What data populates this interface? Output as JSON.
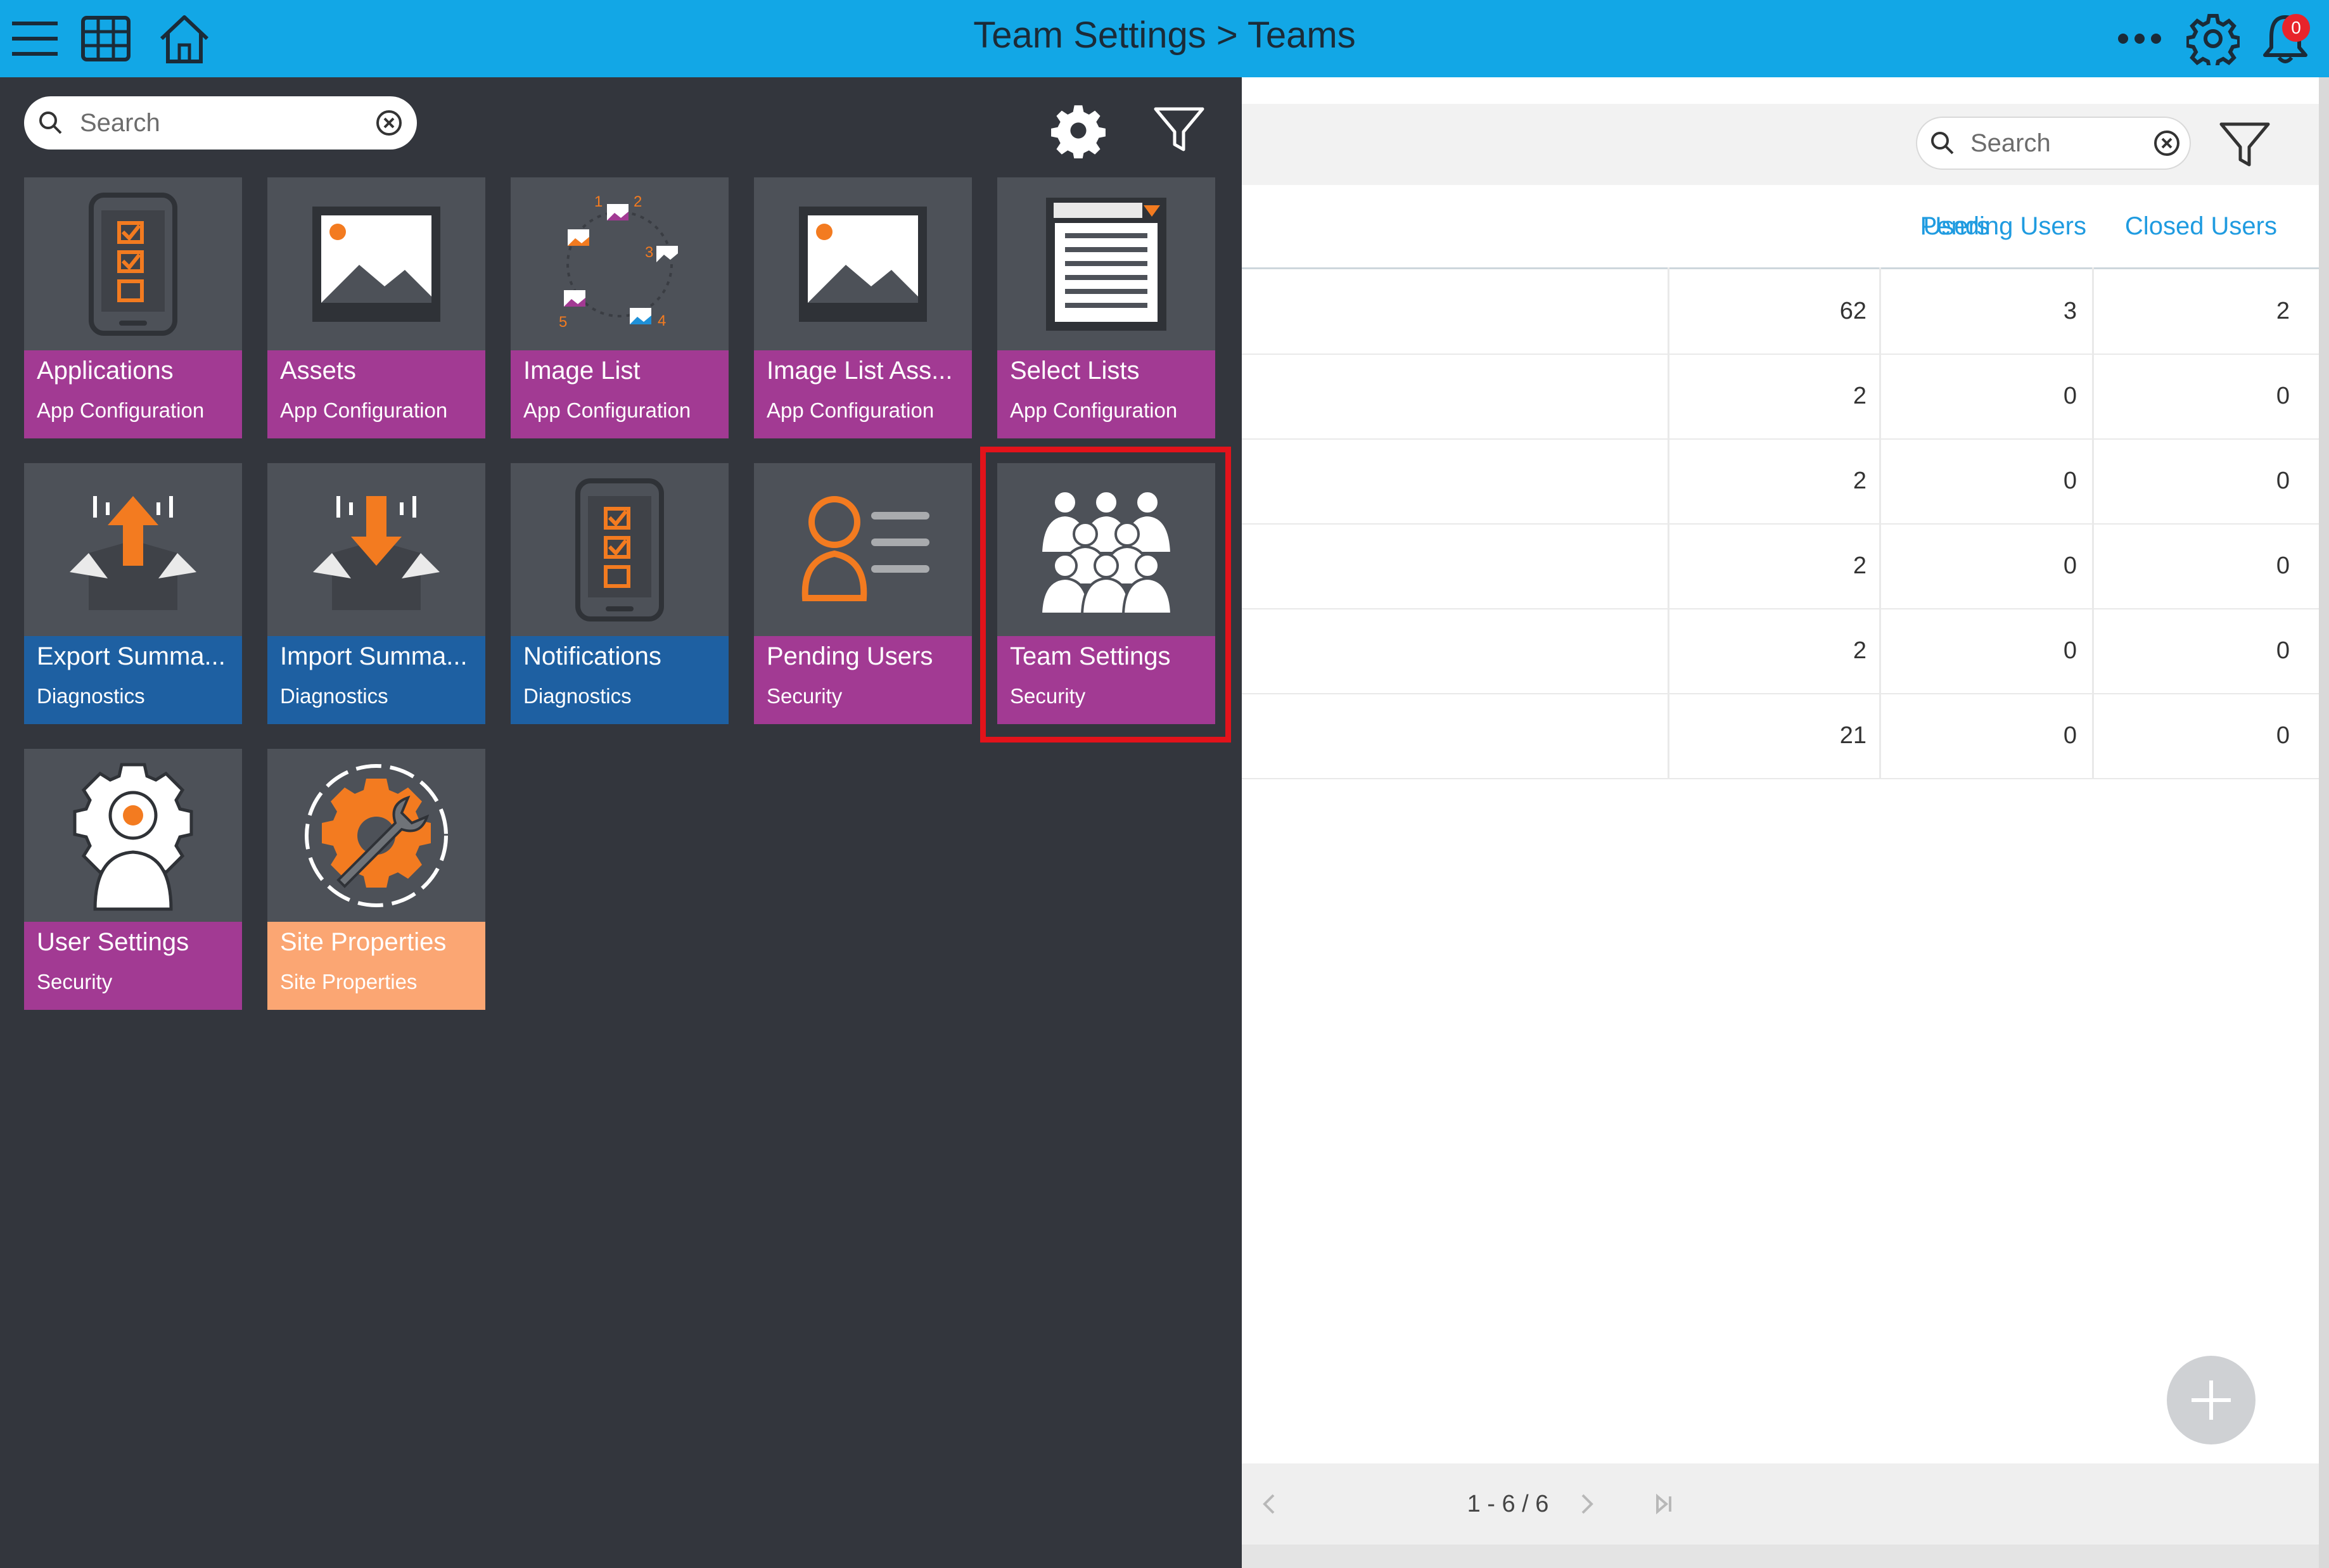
{
  "header": {
    "title": "Team Settings > Teams",
    "notification_count": "0",
    "bg": "#12a7e6"
  },
  "launcher": {
    "search_placeholder": "Search",
    "tiles": [
      {
        "title": "Applications",
        "category": "App Configuration",
        "icon": "phone-checklist-icon"
      },
      {
        "title": "Assets",
        "category": "App Configuration",
        "icon": "image-icon"
      },
      {
        "title": "Image List",
        "category": "App Configuration",
        "icon": "image-list-icon"
      },
      {
        "title": "Image List Ass...",
        "category": "App Configuration",
        "icon": "image-icon"
      },
      {
        "title": "Select Lists",
        "category": "App Configuration",
        "icon": "select-list-icon"
      },
      {
        "title": "Export Summa...",
        "category": "Diagnostics",
        "icon": "export-box-icon"
      },
      {
        "title": "Import Summa...",
        "category": "Diagnostics",
        "icon": "import-box-icon"
      },
      {
        "title": "Notifications",
        "category": "Diagnostics",
        "icon": "phone-checklist-icon"
      },
      {
        "title": "Pending Users",
        "category": "Security",
        "icon": "pending-user-icon"
      },
      {
        "title": "Team Settings",
        "category": "Security",
        "icon": "team-group-icon"
      },
      {
        "title": "User Settings",
        "category": "Security",
        "icon": "user-gear-icon"
      },
      {
        "title": "Site Properties",
        "category": "Site Properties",
        "icon": "wrench-gear-icon"
      }
    ],
    "colors": {
      "app_config": "#a23a93",
      "diagnostics": "#1e60a2",
      "security": "#a23a93",
      "site": "#fba673",
      "accent": "#f37b20"
    }
  },
  "table": {
    "search_placeholder": "Search",
    "columns": [
      "Users",
      "Pending Users",
      "Closed Users"
    ],
    "rows": [
      [
        "62",
        "3",
        "2"
      ],
      [
        "2",
        "0",
        "0"
      ],
      [
        "2",
        "0",
        "0"
      ],
      [
        "2",
        "0",
        "0"
      ],
      [
        "2",
        "0",
        "0"
      ],
      [
        "21",
        "0",
        "0"
      ]
    ],
    "pagination": "1 - 6 / 6"
  }
}
